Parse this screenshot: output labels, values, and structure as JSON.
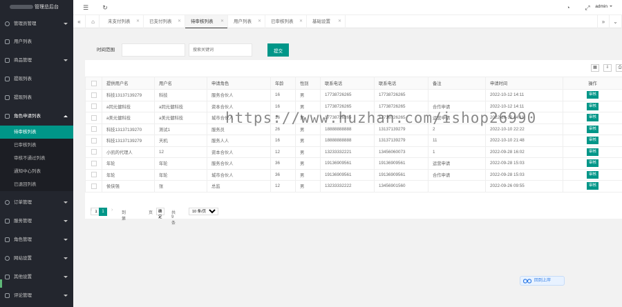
{
  "app": {
    "title": "管理总后台",
    "user": "admin"
  },
  "sidebar": {
    "items": [
      {
        "label": "管理员管理",
        "icon": "settings-icon"
      },
      {
        "label": "用户列表",
        "icon": "user-icon"
      },
      {
        "label": "商品管理",
        "icon": "shop-icon"
      },
      {
        "label": "提现列表",
        "icon": "list-icon"
      },
      {
        "label": "提现列表",
        "icon": "phone-icon"
      }
    ],
    "open_menu": {
      "label": "角色申请列表",
      "children": [
        "待审核列表",
        "已审核列表",
        "审核不通过列表",
        "通知中心列表",
        "已退回列表"
      ]
    },
    "bottom_items": [
      {
        "label": "订单管理",
        "icon": "order-icon"
      },
      {
        "label": "服务管理",
        "icon": "service-icon"
      },
      {
        "label": "角色管理",
        "icon": "role-icon"
      },
      {
        "label": "网站设置",
        "icon": "web-icon"
      },
      {
        "label": "其他设置",
        "icon": "other-icon"
      },
      {
        "label": "评论管理",
        "icon": "comment-icon"
      }
    ]
  },
  "tabs": [
    {
      "label": "未支付列表"
    },
    {
      "label": "已支付列表"
    },
    {
      "label": "待审核列表",
      "active": true
    },
    {
      "label": "用户列表"
    },
    {
      "label": "已审核列表"
    },
    {
      "label": "基础设置"
    }
  ],
  "search": {
    "label": "时间范围",
    "date_placeholder": "",
    "keyword_placeholder": "搜索关键词",
    "submit_label": "提交"
  },
  "table": {
    "columns": [
      "提供用户名",
      "用户名",
      "申请角色",
      "年龄",
      "性别",
      "联系电话",
      "联系电话",
      "备注",
      "申请时间",
      "操作"
    ],
    "rows": [
      [
        "科技13137139279",
        "科技",
        "服务合伙人",
        "16",
        "男",
        "17738726265",
        "17738726265",
        "",
        "2022-10-12 14:11",
        "审核"
      ],
      [
        "a同元健科技",
        "a同元健科技",
        "资本合伙人",
        "16",
        "男",
        "17738726265",
        "17738726265",
        "合作申请",
        "2022-10-12 14:11",
        "审核"
      ],
      [
        "a美元健科技",
        "a美元健科技",
        "城市合伙人",
        "16",
        "男",
        "17738726265",
        "17738726265",
        "运营申请",
        "2022-10-12 14:11",
        "审核"
      ],
      [
        "科技13137139270",
        "测试1",
        "服务员",
        "26",
        "男",
        "18888888888",
        "13137139279",
        "2",
        "2022-10-10 22:22",
        "审核"
      ],
      [
        "科技13137139279",
        "天机",
        "服务人人",
        "16",
        "男",
        "18888888888",
        "13137139279",
        "11",
        "2022-10-10 21:48",
        "审核"
      ],
      [
        "小凯的代理人",
        "12",
        "资本合伙人",
        "12",
        "男",
        "13233332221",
        "13456060073",
        "1",
        "2022-09-28 16:02",
        "审核"
      ],
      [
        "年轮",
        "年轮",
        "服务合伙人",
        "36",
        "男",
        "19136909561",
        "19136909561",
        "运营申请",
        "2022-09-28 15:03",
        "审核"
      ],
      [
        "年轮",
        "年轮",
        "城市合伙人",
        "36",
        "男",
        "19136909561",
        "19136909561",
        "合作申请",
        "2022-09-28 15:03",
        "审核"
      ],
      [
        "侯侠强",
        "张",
        "总监",
        "12",
        "男",
        "13233332222",
        "13456901560",
        "",
        "2022-09-26 09:55",
        "审核"
      ]
    ]
  },
  "pager": {
    "current_page": "1",
    "goto_prefix": "到第",
    "goto_value": "1",
    "goto_suffix": "页",
    "confirm_label": "确定",
    "total": "共 9 条",
    "page_size": "10 条/页"
  },
  "watermark": "https://www.huzhan.com/ishop26990",
  "float_button": {
    "label": "回到上岸"
  },
  "colors": {
    "accent": "#009688",
    "sidebar_bg": "#23262e"
  }
}
